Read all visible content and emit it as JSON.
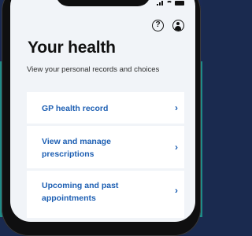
{
  "header": {
    "help_icon_glyph": "?",
    "help_icon": "question-circle-icon",
    "profile_icon": "user-circle-icon"
  },
  "page": {
    "title": "Your health",
    "subtitle": "View your personal records and choices"
  },
  "menu": [
    {
      "label": "GP health record",
      "chevron": "›"
    },
    {
      "label": "View and manage prescriptions",
      "chevron": "›"
    },
    {
      "label": "Upcoming and past appointments",
      "chevron": "›"
    }
  ],
  "colors": {
    "link": "#1d5fb3",
    "screen_bg": "#f1f4f8",
    "backdrop_top": "#1b2a52",
    "backdrop_bottom": "#1f8c88"
  }
}
